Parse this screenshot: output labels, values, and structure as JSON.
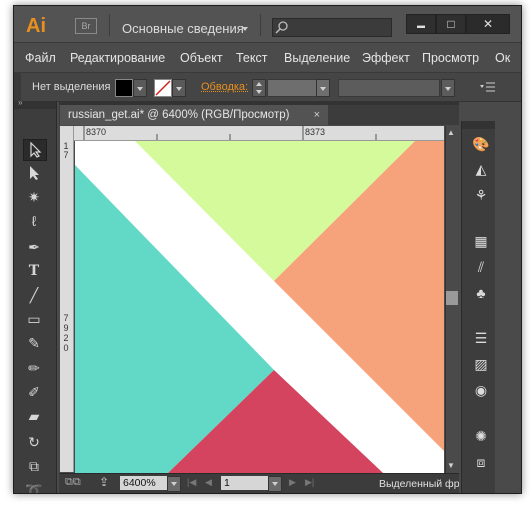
{
  "app": {
    "logo": "Ai",
    "bridge_badge": "Br",
    "workspace": "Основные сведения",
    "search_placeholder": "",
    "window_buttons": {
      "minimize": "▬",
      "maximize": "□",
      "close": "✕"
    }
  },
  "menu": [
    "Файл",
    "Редактирование",
    "Объект",
    "Текст",
    "Выделение",
    "Эффект",
    "Просмотр",
    "Ок"
  ],
  "control_bar": {
    "selection_label": "Нет выделения",
    "stroke_label": "Обводка:",
    "stroke_value": "",
    "style_value": ""
  },
  "document": {
    "tab_title": "russian_get.ai* @ 6400% (RGB/Просмотр)",
    "tab_close": "×"
  },
  "rulers": {
    "top_left": "8370",
    "top_right": "8373",
    "left_upper": [
      "1",
      "7"
    ],
    "left_lower": [
      "7",
      "9",
      "2",
      "0"
    ]
  },
  "status": {
    "zoom": "6400%",
    "page": "1",
    "info": "Выделенный фрагмент"
  },
  "artwork_colors": {
    "teal": "#62d9c7",
    "lime": "#d4fa9c",
    "orange": "#f6a27a",
    "crimson": "#d4445e",
    "white": "#ffffff"
  },
  "tools": [
    "selection-icon",
    "direct-selection-icon",
    "magic-wand-icon",
    "lasso-icon",
    "pen-icon",
    "type-icon",
    "line-icon",
    "rectangle-icon",
    "paintbrush-icon",
    "pencil-icon",
    "blob-brush-icon",
    "eraser-icon",
    "rotate-icon",
    "scale-icon",
    "warp-icon"
  ],
  "panels": [
    "color-palette-icon",
    "color-guide-icon",
    "symbols-icon",
    "swatches-icon",
    "brushes-icon",
    "clubs-symbol-icon",
    "stroke-icon",
    "gradient-icon",
    "transparency-icon",
    "appearance-icon",
    "layers-icon"
  ]
}
